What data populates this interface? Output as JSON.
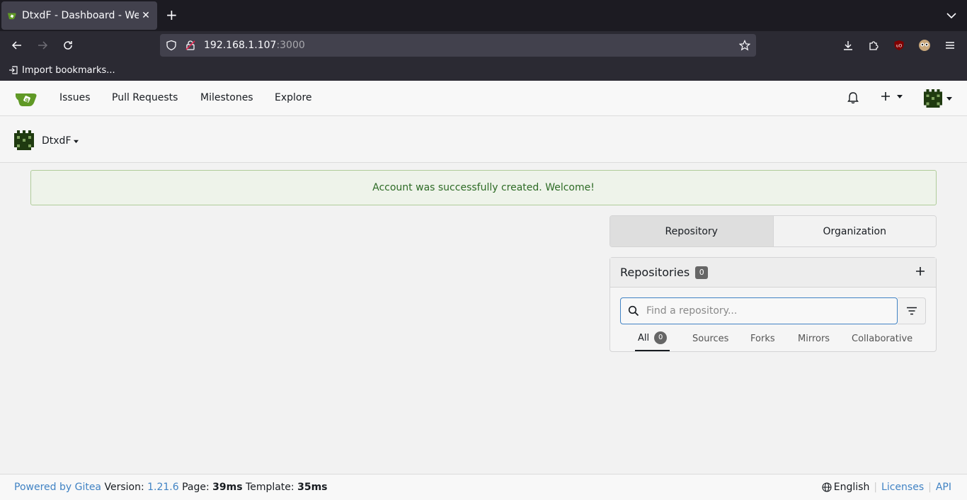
{
  "browser": {
    "tab_title": "DtxdF - Dashboard - Welcome",
    "url_host": "192.168.1.107",
    "url_port": ":3000",
    "bookmarks_label": "Import bookmarks..."
  },
  "header": {
    "nav": [
      "Issues",
      "Pull Requests",
      "Milestones",
      "Explore"
    ]
  },
  "context": {
    "username": "DtxdF"
  },
  "alert": {
    "message": "Account was successfully created. Welcome!"
  },
  "dashboard": {
    "tabs": [
      "Repository",
      "Organization"
    ],
    "active_tab": "Repository"
  },
  "repos": {
    "title": "Repositories",
    "count": "0",
    "search_placeholder": "Find a repository...",
    "filter_tabs": [
      {
        "label": "All",
        "count": "0"
      },
      {
        "label": "Sources"
      },
      {
        "label": "Forks"
      },
      {
        "label": "Mirrors"
      },
      {
        "label": "Collaborative"
      }
    ]
  },
  "footer": {
    "powered": "Powered by Gitea",
    "version_label": "Version:",
    "version": "1.21.6",
    "page_label": "Page:",
    "page_time": "39ms",
    "template_label": "Template:",
    "template_time": "35ms",
    "language": "English",
    "licenses": "Licenses",
    "api": "API"
  },
  "colors": {
    "accent_link": "#4183c4",
    "success_text": "#2d6b25",
    "gitea_green": "#609926"
  }
}
